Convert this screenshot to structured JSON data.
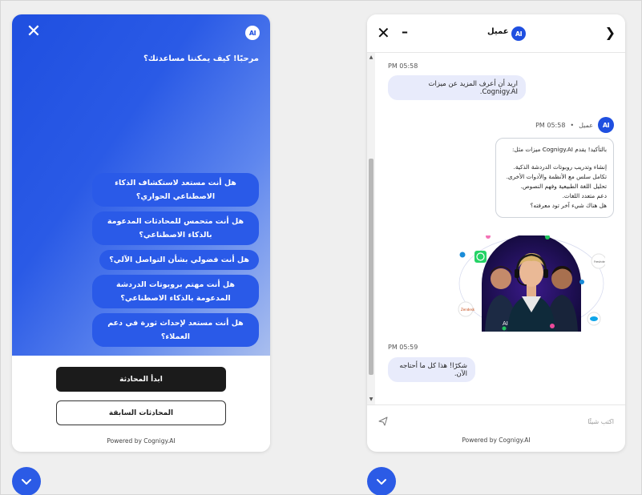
{
  "left": {
    "greeting": "مرحبًا! كيف يمكننا مساعدتك؟",
    "logo_text": "AI",
    "close_label": "✕",
    "suggestions": [
      "هل أنت مستعد لاستكشاف الذكاء الاصطناعي الحواري؟",
      "هل أنت متحمس للمحادثات المدعومة بالذكاء الاصطناعي؟",
      "هل أنت فضولي بشأن التواصل الآلي؟",
      "هل أنت مهتم بروبوتات الدردشة المدعومة بالذكاء الاصطناعي؟",
      "هل أنت مستعد لإحداث ثورة في دعم العملاء؟"
    ],
    "start_button": "ابدأ المحادثة",
    "previous_button": "المحادثات السابقة",
    "powered_by": "Powered by Cognigy.AI"
  },
  "right": {
    "title": "عميل",
    "logo_text": "AI",
    "close_label": "✕",
    "minimize_label": "–",
    "back_label": "❯",
    "messages": {
      "user1_time": "PM 05:58",
      "user1_text": "اريد أن أعرف المزيد عن ميزات Cognigy.AI.",
      "bot_time": "PM 05:58",
      "bot_name": "عميل",
      "bot_sep": "•",
      "bot_intro": "بالتأكيد! يقدم Cognigy.AI ميزات مثل:",
      "bot_points": [
        "إنشاء وتدريب روبوتات الدردشة الذكية.",
        "تكامل سلس مع الأنظمة والأدوات الأخرى.",
        "تحليل اللغة الطبيعية وفهم النصوص.",
        "دعم متعدد اللغات."
      ],
      "bot_outro": "هل هناك شيء آخر تود معرفته؟",
      "user2_time": "PM 05:59",
      "user2_text": "شكرًا! هذا كل ما أحتاجه الآن."
    },
    "input_placeholder": "اكتب شيئًا",
    "powered_by": "Powered by Cognigy.AI"
  },
  "colors": {
    "brand": "#1f4fe0",
    "suggestion": "#2a5ae8",
    "user_bubble": "#e8ebfb",
    "dark_button": "#1b1b1b"
  },
  "icons": {
    "close": "close-icon",
    "minimize": "minimize-icon",
    "back": "chevron-right-icon",
    "send": "send-icon",
    "fab": "chevron-down-icon",
    "whatsapp": "whatsapp-icon"
  }
}
